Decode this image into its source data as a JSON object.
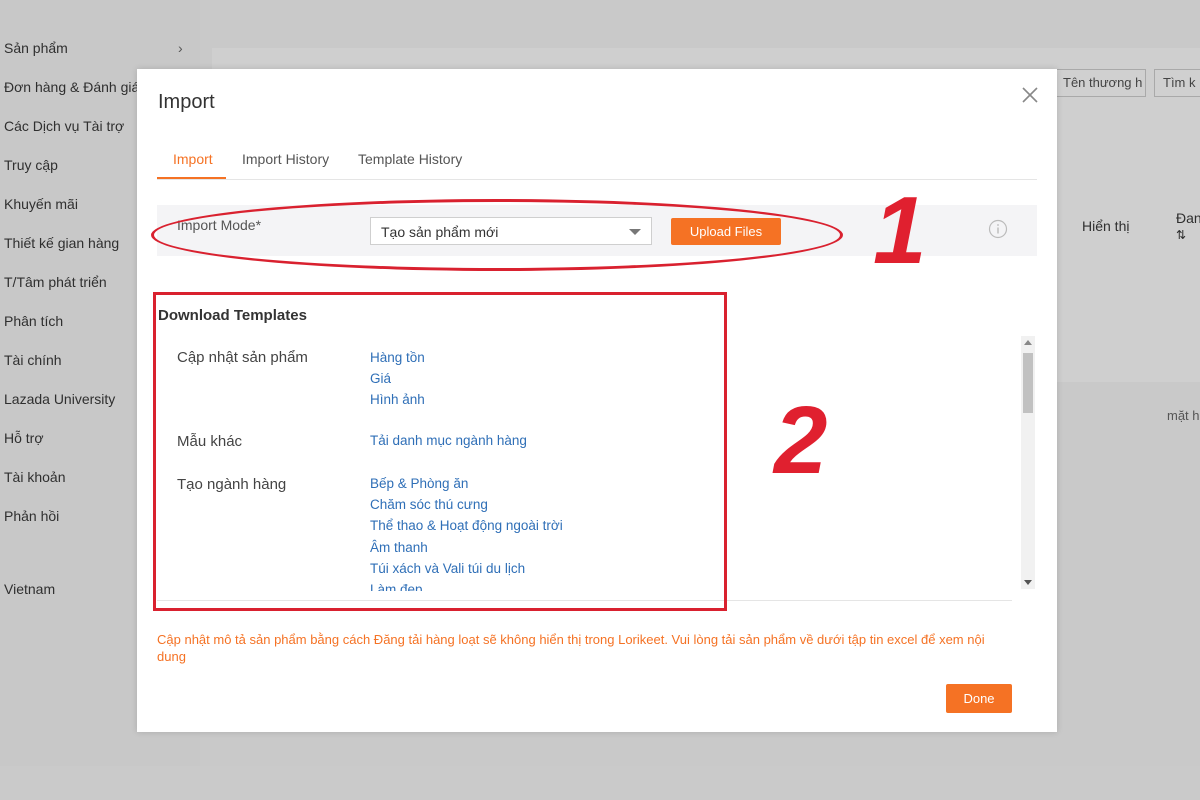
{
  "sidebar": {
    "items": [
      {
        "label": "Sản phẩm"
      },
      {
        "label": "Đơn hàng & Đánh giá"
      },
      {
        "label": "Các Dịch vụ Tài trợ"
      },
      {
        "label": "Truy cập"
      },
      {
        "label": "Khuyến mãi"
      },
      {
        "label": "Thiết kế gian hàng"
      },
      {
        "label": "T/Tâm phát triển"
      },
      {
        "label": "Phân tích"
      },
      {
        "label": "Tài chính"
      },
      {
        "label": "Lazada University"
      },
      {
        "label": "Hỗ trợ"
      },
      {
        "label": "Tài khoản"
      },
      {
        "label": "Phản hồi"
      }
    ],
    "region": "Vietnam",
    "expand_icon": "chevron-right-icon"
  },
  "background": {
    "search_placeholder": "Tên thương h",
    "search_button": "Tìm k",
    "col_display": "Hiển thị",
    "col_status": "Đan",
    "sort_icon": "sort-icon",
    "side_text": "mặt h"
  },
  "modal": {
    "title": "Import",
    "close_icon": "close-icon",
    "tabs": [
      {
        "label": "Import",
        "active": true
      },
      {
        "label": "Import History",
        "active": false
      },
      {
        "label": "Template History",
        "active": false
      }
    ],
    "import_mode": {
      "label": "Import Mode*",
      "selected": "Tạo sản phẩm mới",
      "upload_label": "Upload Files",
      "info_icon": "info-icon"
    },
    "download": {
      "heading": "Download Templates",
      "groups": [
        {
          "category": "Cập nhật sản phẩm",
          "links": [
            "Hàng tồn",
            "Giá",
            "Hình ảnh"
          ]
        },
        {
          "category": "Mẫu khác",
          "links": [
            "Tải danh mục ngành hàng"
          ]
        },
        {
          "category": "Tạo ngành hàng",
          "links": [
            "Bếp & Phòng ăn",
            "Chăm sóc thú cưng",
            "Thể thao & Hoạt động ngoài trời",
            "Âm thanh",
            "Túi xách và Vali túi du lịch",
            "Làm đẹp"
          ]
        }
      ]
    },
    "notice": "Cập nhật mô tả sản phẩm bằng cách Đăng tải hàng loạt sẽ không hiển thị trong Lorikeet. Vui lòng tải sản phẩm về dưới tập tin excel để xem nội dung",
    "done_label": "Done"
  },
  "annotations": {
    "marker_1": "1",
    "marker_2": "2",
    "color": "#d9212f"
  },
  "colors": {
    "accent": "#f57224",
    "link": "#2f6fb7"
  }
}
